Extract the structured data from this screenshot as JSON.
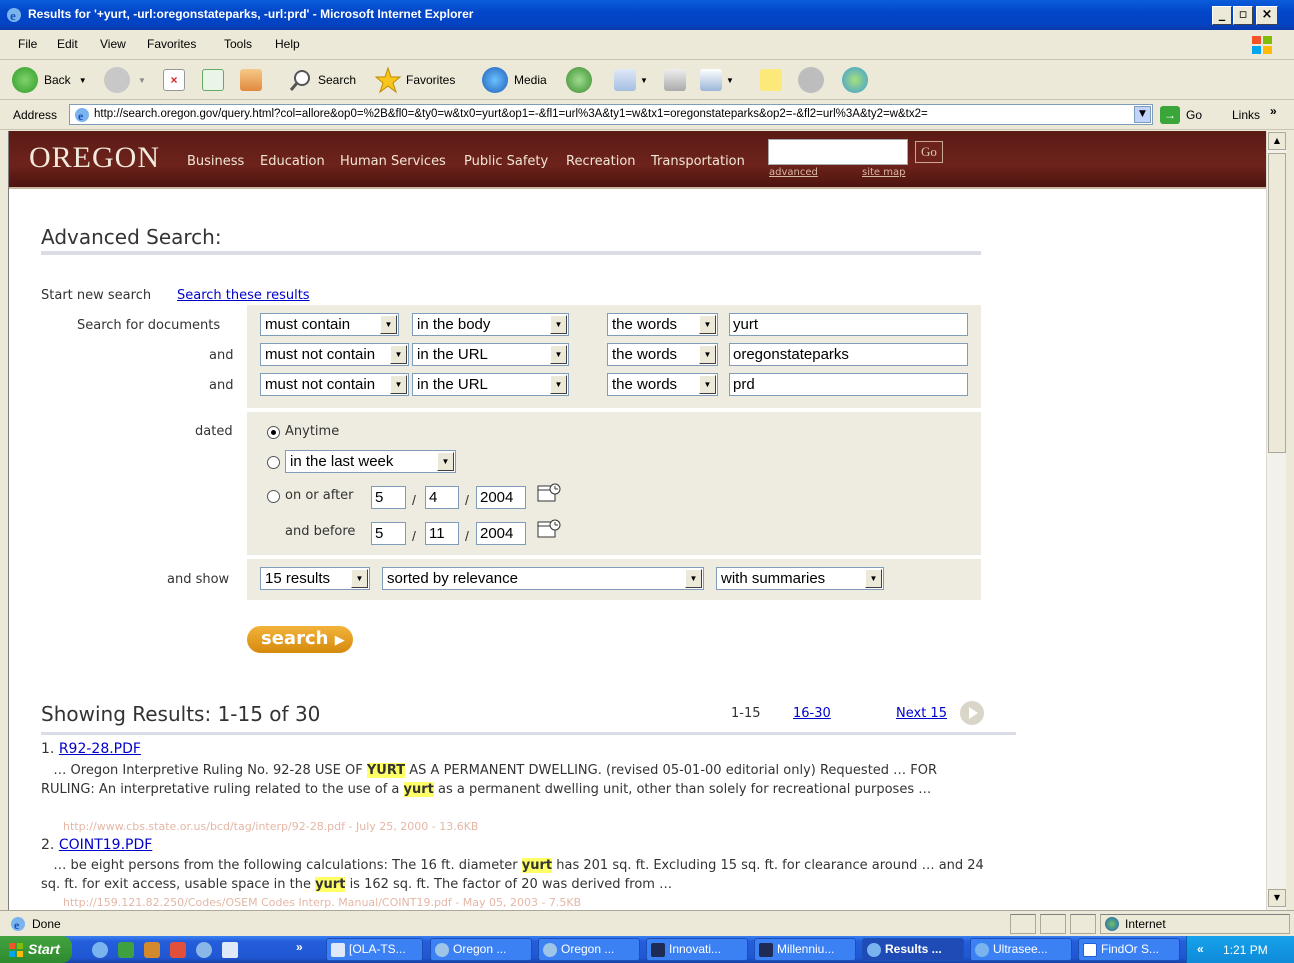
{
  "window": {
    "title": "Results for '+yurt, -url:oregonstateparks, -url:prd' - Microsoft Internet Explorer",
    "min": "_",
    "max": "▫",
    "close": "×"
  },
  "menu": [
    "File",
    "Edit",
    "View",
    "Favorites",
    "Tools",
    "Help"
  ],
  "toolbar": {
    "back": "Back",
    "search": "Search",
    "favorites": "Favorites",
    "media": "Media"
  },
  "address": {
    "label": "Address",
    "url": "http://search.oregon.gov/query.html?col=allore&op0=%2B&fl0=&ty0=w&tx0=yurt&op1=-&fl1=url%3A&ty1=w&tx1=oregonstateparks&op2=-&fl2=url%3A&ty2=w&tx2=",
    "go": "Go",
    "links": "Links"
  },
  "banner": {
    "logo": "OREGON",
    "nav": [
      "Business",
      "Education",
      "Human Services",
      "Public Safety",
      "Recreation",
      "Transportation"
    ],
    "go": "Go",
    "advanced": "advanced",
    "site_map": "site map"
  },
  "advanced": {
    "heading": "Advanced Search:",
    "start_new": "Start new search",
    "search_these": "Search these results",
    "search_for": "Search for documents",
    "and": "and",
    "rows": [
      {
        "op": "must contain",
        "where": "in the body",
        "type": "the words",
        "text": "yurt"
      },
      {
        "op": "must not contain",
        "where": "in the URL",
        "type": "the words",
        "text": "oregonstateparks"
      },
      {
        "op": "must not contain",
        "where": "in the URL",
        "type": "the words",
        "text": "prd"
      }
    ],
    "dated": "dated",
    "anytime": "Anytime",
    "in_last": "in the last week",
    "on_or_after": "on or after",
    "and_before": "and before",
    "after": {
      "m": "5",
      "d": "4",
      "y": "2004"
    },
    "before": {
      "m": "5",
      "d": "11",
      "y": "2004"
    },
    "and_show": "and show",
    "count": "15 results",
    "sort": "sorted by relevance",
    "summaries": "with summaries",
    "search_btn": "search"
  },
  "results": {
    "heading": "Showing Results: 1-15 of 30",
    "range": "1-15",
    "next_range": "16-30",
    "next": "Next 15",
    "items": [
      {
        "num": "1.",
        "title": "R92-28.PDF",
        "url": "http://www.cbs.state.or.us/bcd/tag/interp/92-28.pdf - July 25, 2000 - 13.6KB"
      },
      {
        "num": "2.",
        "title": "COINT19.PDF",
        "url": "http://159.121.82.250/Codes/OSEM Codes Interp. Manual/COINT19.pdf - May 05, 2003 - 7.5KB"
      }
    ]
  },
  "status": {
    "done": "Done",
    "zone": "Internet"
  },
  "taskbar": {
    "start": "Start",
    "tasks": [
      "[OLA-TS...",
      "Oregon ...",
      "Oregon ...",
      "Innovati...",
      "Millenniu...",
      "Results ...",
      "Ultrasee...",
      "FindOr S..."
    ],
    "clock": "1:21 PM",
    "chev": "«",
    "more": "»"
  }
}
